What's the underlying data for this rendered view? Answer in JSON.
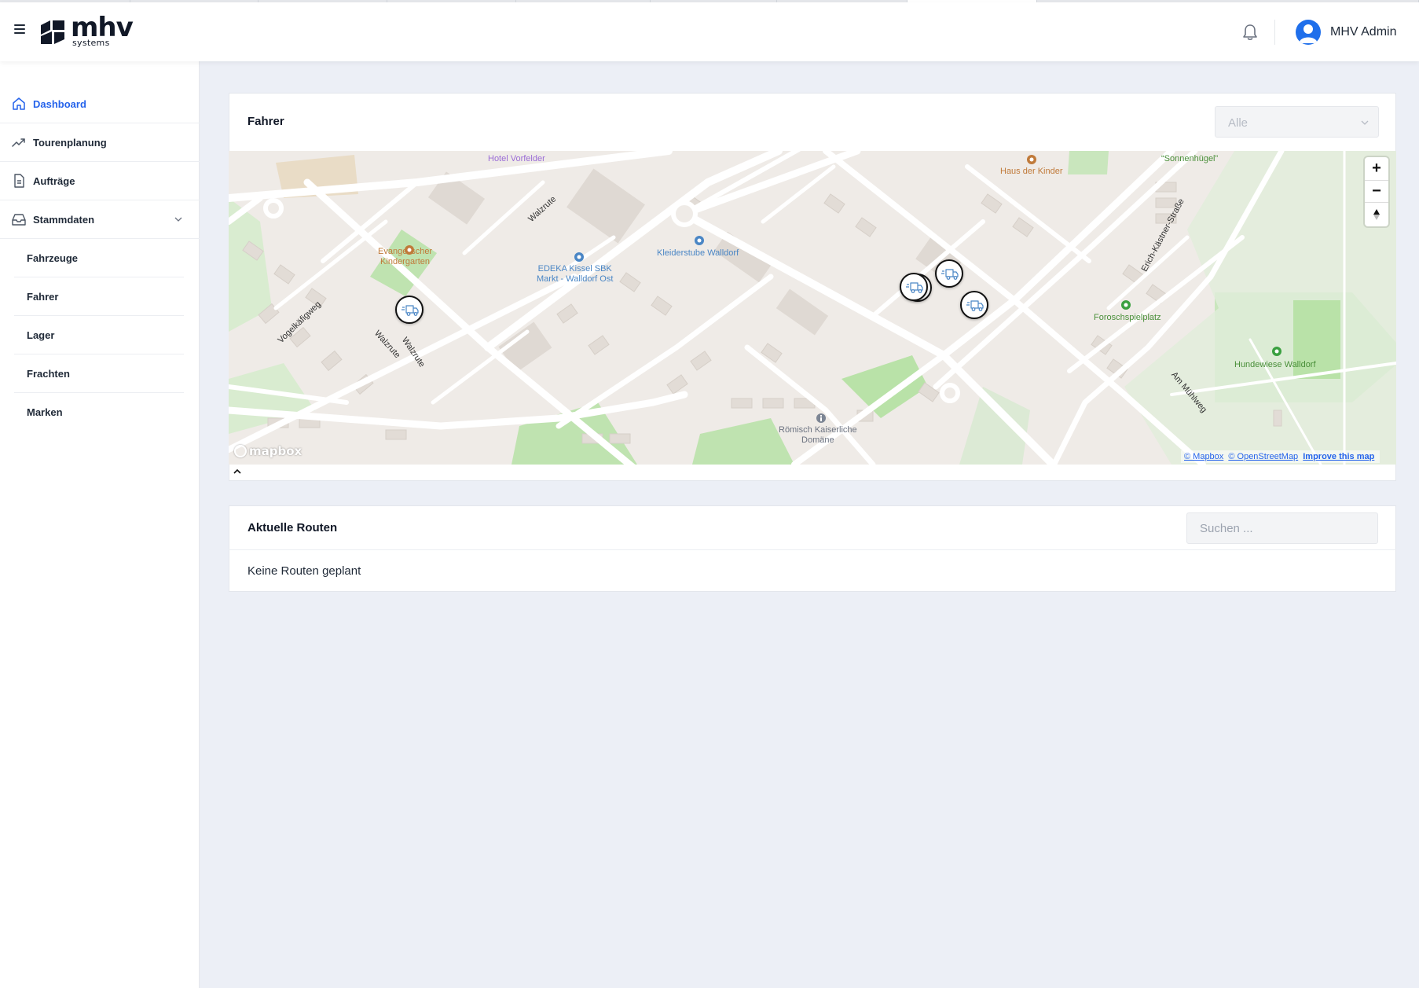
{
  "header": {
    "brand": "mhv",
    "brand_sub": "systems",
    "user_name": "MHV Admin"
  },
  "sidebar": {
    "items": [
      {
        "label": "Dashboard",
        "icon": "home-icon",
        "active": true
      },
      {
        "label": "Tourenplanung",
        "icon": "trend-up-icon",
        "active": false
      },
      {
        "label": "Aufträge",
        "icon": "document-icon",
        "active": false
      },
      {
        "label": "Stammdaten",
        "icon": "inbox-icon",
        "active": false,
        "expanded": true
      }
    ],
    "sub_items": [
      {
        "label": "Fahrzeuge"
      },
      {
        "label": "Fahrer"
      },
      {
        "label": "Lager"
      },
      {
        "label": "Frachten"
      },
      {
        "label": "Marken"
      }
    ]
  },
  "drivers_card": {
    "title": "Fahrer",
    "filter_value": "Alle"
  },
  "map": {
    "labels": {
      "hotel": "Hotel Vorfelder",
      "haus_kinder": "Haus der Kinder",
      "sonnenhuegel": "“Sonnenhügel”",
      "walzrute_top": "Walzrute",
      "kindergarten_1": "Evangelischer",
      "kindergarten_2": "Kindergarten",
      "edeka_1": "EDEKA Kissel SBK",
      "edeka_2": "Markt - Walldorf Ost",
      "kleiderstube": "Kleiderstube Walldorf",
      "erich": "Erich-Kästner-Straße",
      "foroschspielplatz": "Foroschspielplatz",
      "hundewiese": "Hundewiese Walldorf",
      "vogelkaefigweg": "Vogelkäfigweg",
      "walzrute_left": "Walzrute",
      "walzrute_left2": "Walzrute",
      "am_muehlweg": "Am Mühlweg",
      "roemisch_1": "Römisch Kaiserliche",
      "roemisch_2": "Domäne"
    },
    "attribution": {
      "mapbox": "© Mapbox",
      "osm": "© OpenStreetMap",
      "improve": "Improve this map"
    },
    "logo": "mapbox",
    "zoom_in": "+",
    "zoom_out": "−"
  },
  "routes_card": {
    "title": "Aktuelle Routen",
    "search_placeholder": "Suchen ...",
    "empty_message": "Keine Routen geplant"
  },
  "colors": {
    "accent": "#2563eb",
    "background": "#eceff6",
    "map_park": "#bfe3b0",
    "map_land": "#efebe7"
  }
}
